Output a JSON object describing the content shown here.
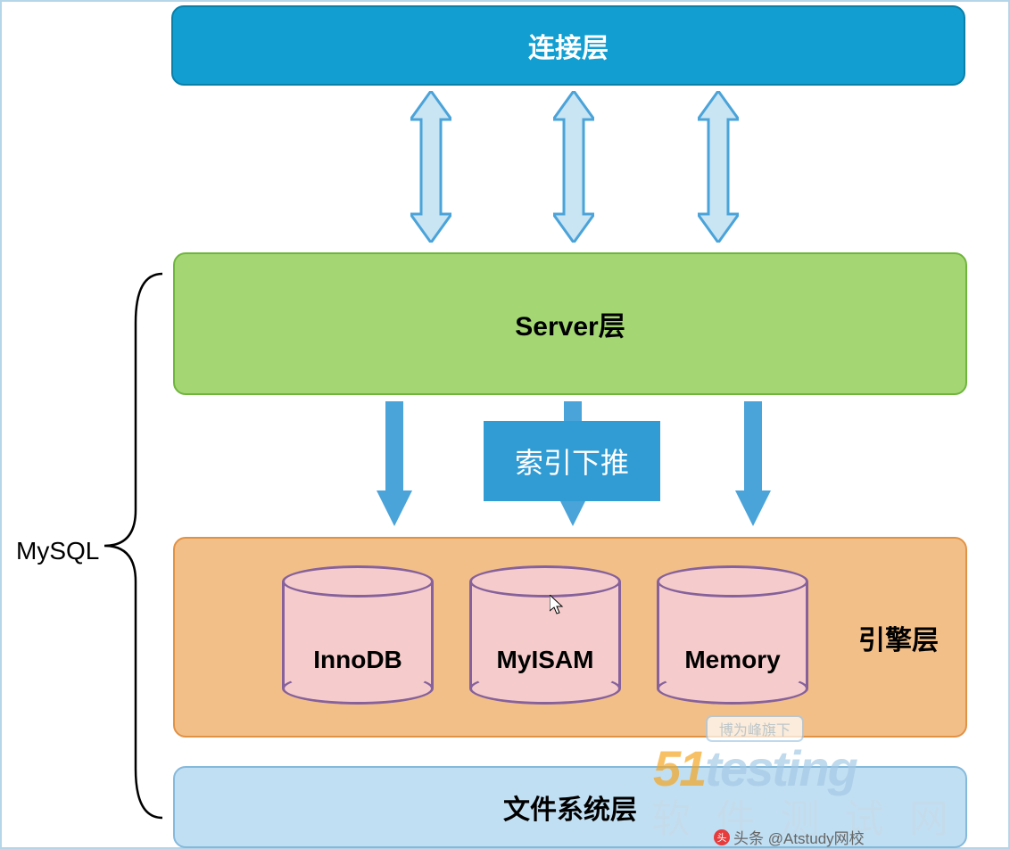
{
  "layers": {
    "connection": "连接层",
    "server": "Server层",
    "index_pushdown": "索引下推",
    "engine_label": "引擎层",
    "filesystem": "文件系统层"
  },
  "engines": [
    {
      "name": "InnoDB"
    },
    {
      "name": "MyISAM"
    },
    {
      "name": "Memory"
    }
  ],
  "sidebar_label": "MySQL",
  "watermark": {
    "badge": "博为峰旗下",
    "brand_prefix": "51",
    "brand_suffix": "testing",
    "subtitle": "软 件 测 试 网"
  },
  "attribution": "头条 @Atstudy网校",
  "colors": {
    "blue": "#129ed1",
    "green": "#a4d774",
    "orange": "#f3bf89",
    "lightblue": "#c1dff2",
    "arrow_blue": "#4aa3d9",
    "arrow_light": "#c9e4f3"
  }
}
